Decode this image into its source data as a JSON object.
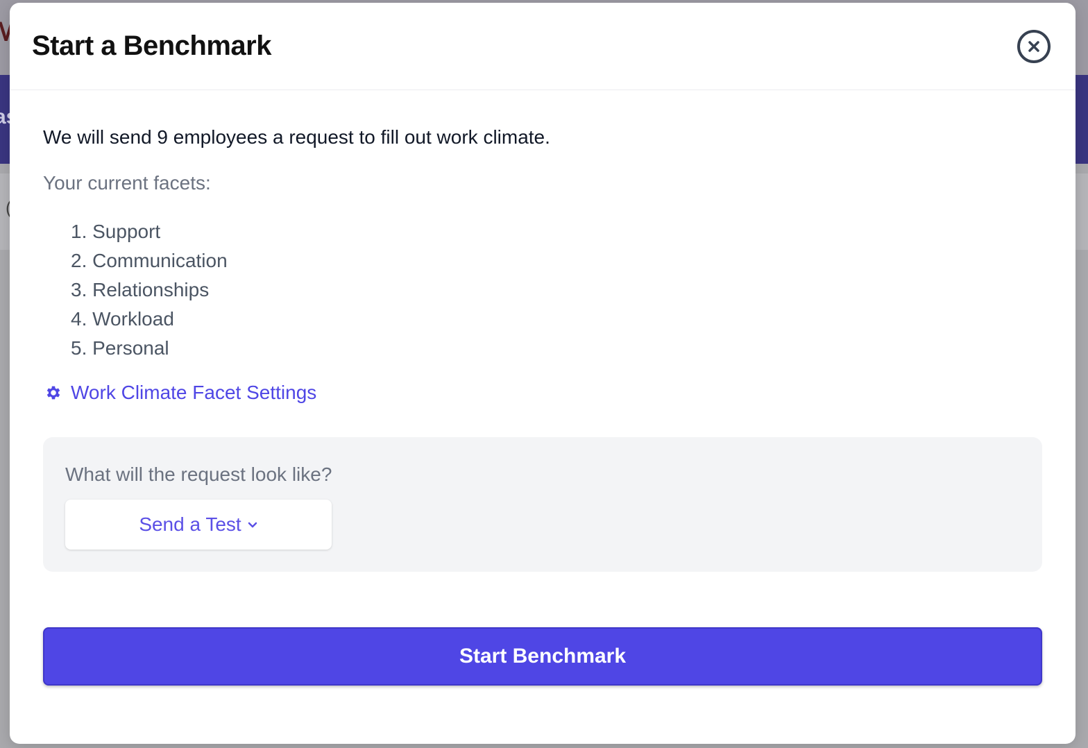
{
  "background": {
    "glyph_top": "M",
    "glyph_band": "as",
    "glyph_rest": "("
  },
  "modal": {
    "title": "Start a Benchmark",
    "close_icon": "close-circle-icon"
  },
  "content": {
    "intro": "We will send 9 employees a request to fill out work climate.",
    "facets_label": "Your current facets:",
    "facets": [
      "1. Support",
      "2. Communication",
      "3. Relationships",
      "4. Workload",
      "5. Personal"
    ],
    "settings_link": "Work Climate Facet Settings",
    "settings_icon": "gear-icon"
  },
  "test_panel": {
    "question": "What will the request look like?",
    "send_test_label": "Send a Test",
    "chevron_icon": "chevron-down-icon"
  },
  "actions": {
    "start_label": "Start Benchmark"
  },
  "colors": {
    "accent": "#4f46e5",
    "panel_bg": "#f3f4f6",
    "title": "#111111",
    "muted": "#6b7280"
  }
}
